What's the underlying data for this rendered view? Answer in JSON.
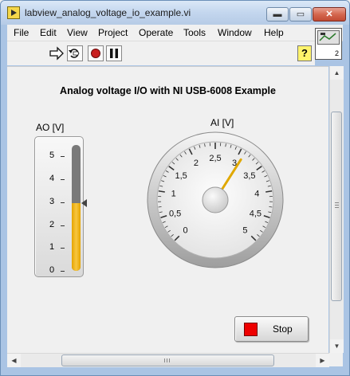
{
  "window": {
    "title": "labview_analog_voltage_io_example.vi",
    "buttons": {
      "minimize": "▬",
      "maximize": "▭",
      "close": "✕"
    }
  },
  "menu": [
    "File",
    "Edit",
    "View",
    "Project",
    "Operate",
    "Tools",
    "Window",
    "Help"
  ],
  "toolbar": {
    "help": "?",
    "icons": [
      "run-arrow-icon",
      "run-continuously-icon",
      "abort-icon",
      "pause-icon",
      "context-help-icon"
    ]
  },
  "connector": {
    "number": "2"
  },
  "panel": {
    "title": "Analog voltage I/O with NI USB-6008 Example",
    "ao": {
      "label": "AO [V]",
      "ticks": [
        "5",
        "4",
        "3",
        "2",
        "1",
        "0"
      ],
      "min": 0,
      "max": 5.5,
      "value": 2.95
    },
    "ai": {
      "label": "AI [V]",
      "ticks": [
        "0",
        "0,5",
        "1",
        "1,5",
        "2",
        "2,5",
        "3",
        "3,5",
        "4",
        "4,5",
        "5"
      ],
      "min": 0,
      "max": 5,
      "value": 3.1
    },
    "stop": {
      "label": "Stop",
      "led_color": "#ee0000"
    }
  },
  "colors": {
    "accent_fill": "#f8c640",
    "needle": "#e0a800"
  }
}
